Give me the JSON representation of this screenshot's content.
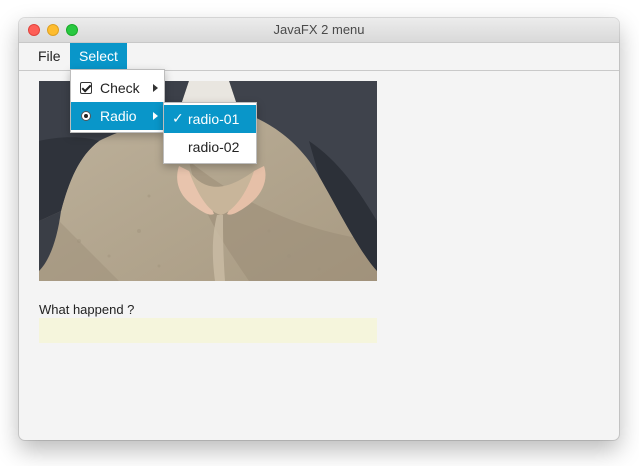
{
  "window": {
    "title": "JavaFX 2 menu"
  },
  "menubar": {
    "file_label": "File",
    "select_label": "Select"
  },
  "select_menu": {
    "items": [
      {
        "label": "Check",
        "icon": "checkbox-icon",
        "checked": true,
        "has_submenu": true
      },
      {
        "label": "Radio",
        "icon": "radio-icon",
        "selected": true,
        "has_submenu": true
      }
    ]
  },
  "radio_submenu": {
    "items": [
      {
        "label": "radio-01",
        "selected": true,
        "check_glyph": "✓"
      },
      {
        "label": "radio-02",
        "selected": false
      }
    ]
  },
  "form": {
    "question_label": "What happend ?",
    "answer_value": ""
  },
  "colors": {
    "accent": "#0996c9",
    "field_background": "#f5f5dc",
    "window_background": "#f4f4f4"
  }
}
